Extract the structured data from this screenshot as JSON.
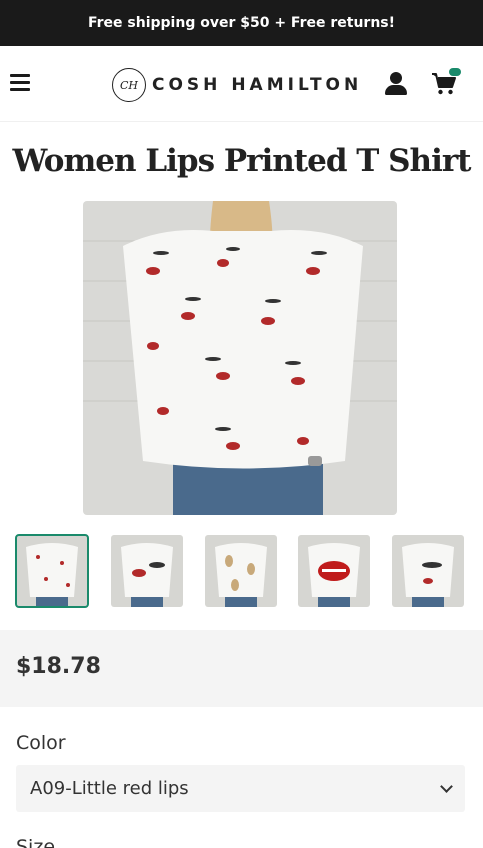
{
  "announcement": "Free shipping over $50 + Free returns!",
  "brand": {
    "mark": "CH",
    "name": "COSH HAMILTON"
  },
  "product": {
    "title": "Women Lips Printed T Shirt",
    "price": "$18.78",
    "color_label": "Color",
    "color_value": "A09-Little red lips",
    "size_label": "Size"
  },
  "thumbnails": [
    {
      "name": "thumb-1",
      "active": true
    },
    {
      "name": "thumb-2",
      "active": false
    },
    {
      "name": "thumb-3",
      "active": false
    },
    {
      "name": "thumb-4",
      "active": false
    },
    {
      "name": "thumb-5",
      "active": false
    }
  ],
  "icons": {
    "menu": "hamburger-menu-icon",
    "user": "user-icon",
    "cart": "cart-icon",
    "chevron": "chevron-down-icon"
  },
  "colors": {
    "accent": "#1a8a6b",
    "bar": "#1a1a1a"
  }
}
